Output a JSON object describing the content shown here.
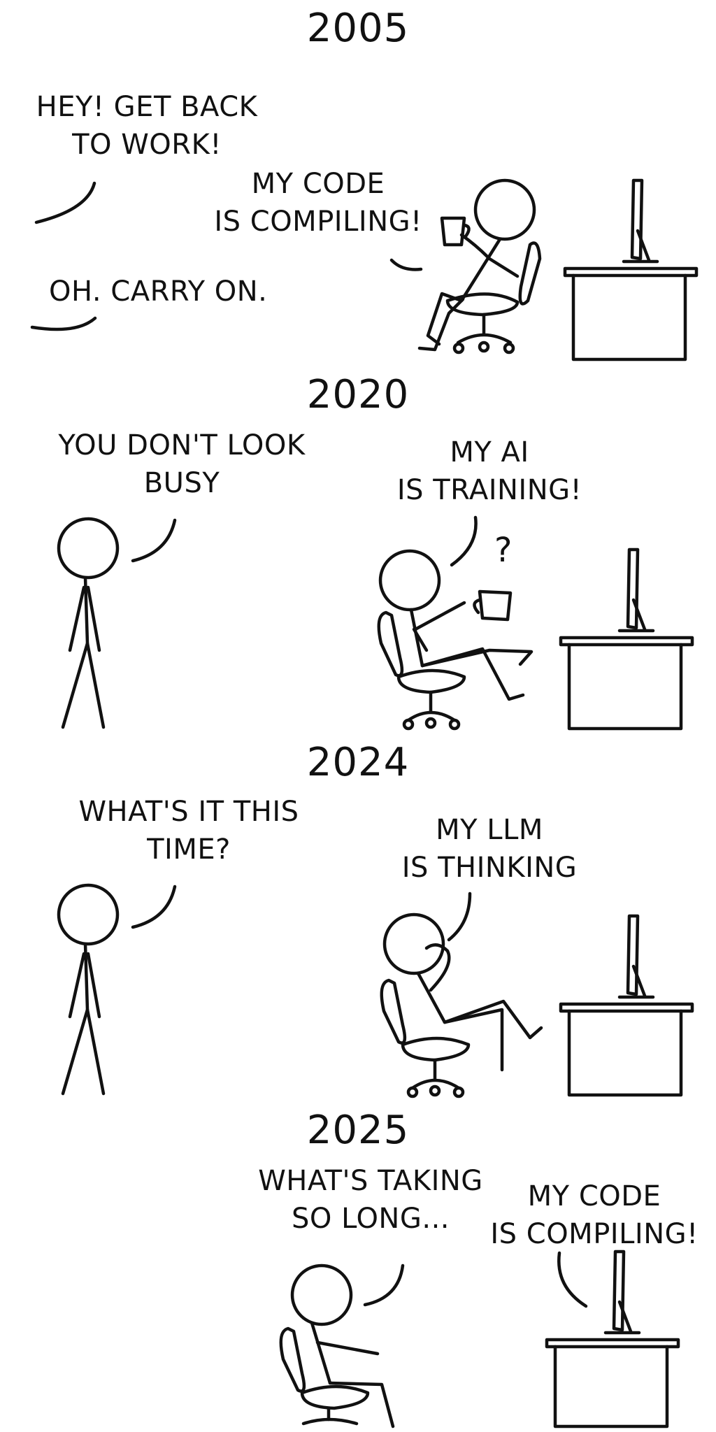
{
  "panels": [
    {
      "year": "2005",
      "lines": [
        {
          "speaker": "boss",
          "text": "HEY! GET BACK\nTO WORK!"
        },
        {
          "speaker": "developer",
          "text": "MY CODE\nIS COMPILING!"
        },
        {
          "speaker": "boss",
          "text": "OH. CARRY ON."
        }
      ]
    },
    {
      "year": "2020",
      "lines": [
        {
          "speaker": "boss",
          "text": "YOU DON'T LOOK\nBUSY"
        },
        {
          "speaker": "developer",
          "text": "MY AI\nIS TRAINING!"
        }
      ],
      "thought_symbol": "?"
    },
    {
      "year": "2024",
      "lines": [
        {
          "speaker": "boss",
          "text": "WHAT'S IT THIS\nTIME?"
        },
        {
          "speaker": "developer",
          "text": "MY LLM\nIS THINKING"
        }
      ]
    },
    {
      "year": "2025",
      "lines": [
        {
          "speaker": "ai-in-chair",
          "text": "WHAT'S TAKING\nSO LONG..."
        },
        {
          "speaker": "computer",
          "text": "MY CODE\nIS COMPILING!"
        }
      ]
    }
  ]
}
